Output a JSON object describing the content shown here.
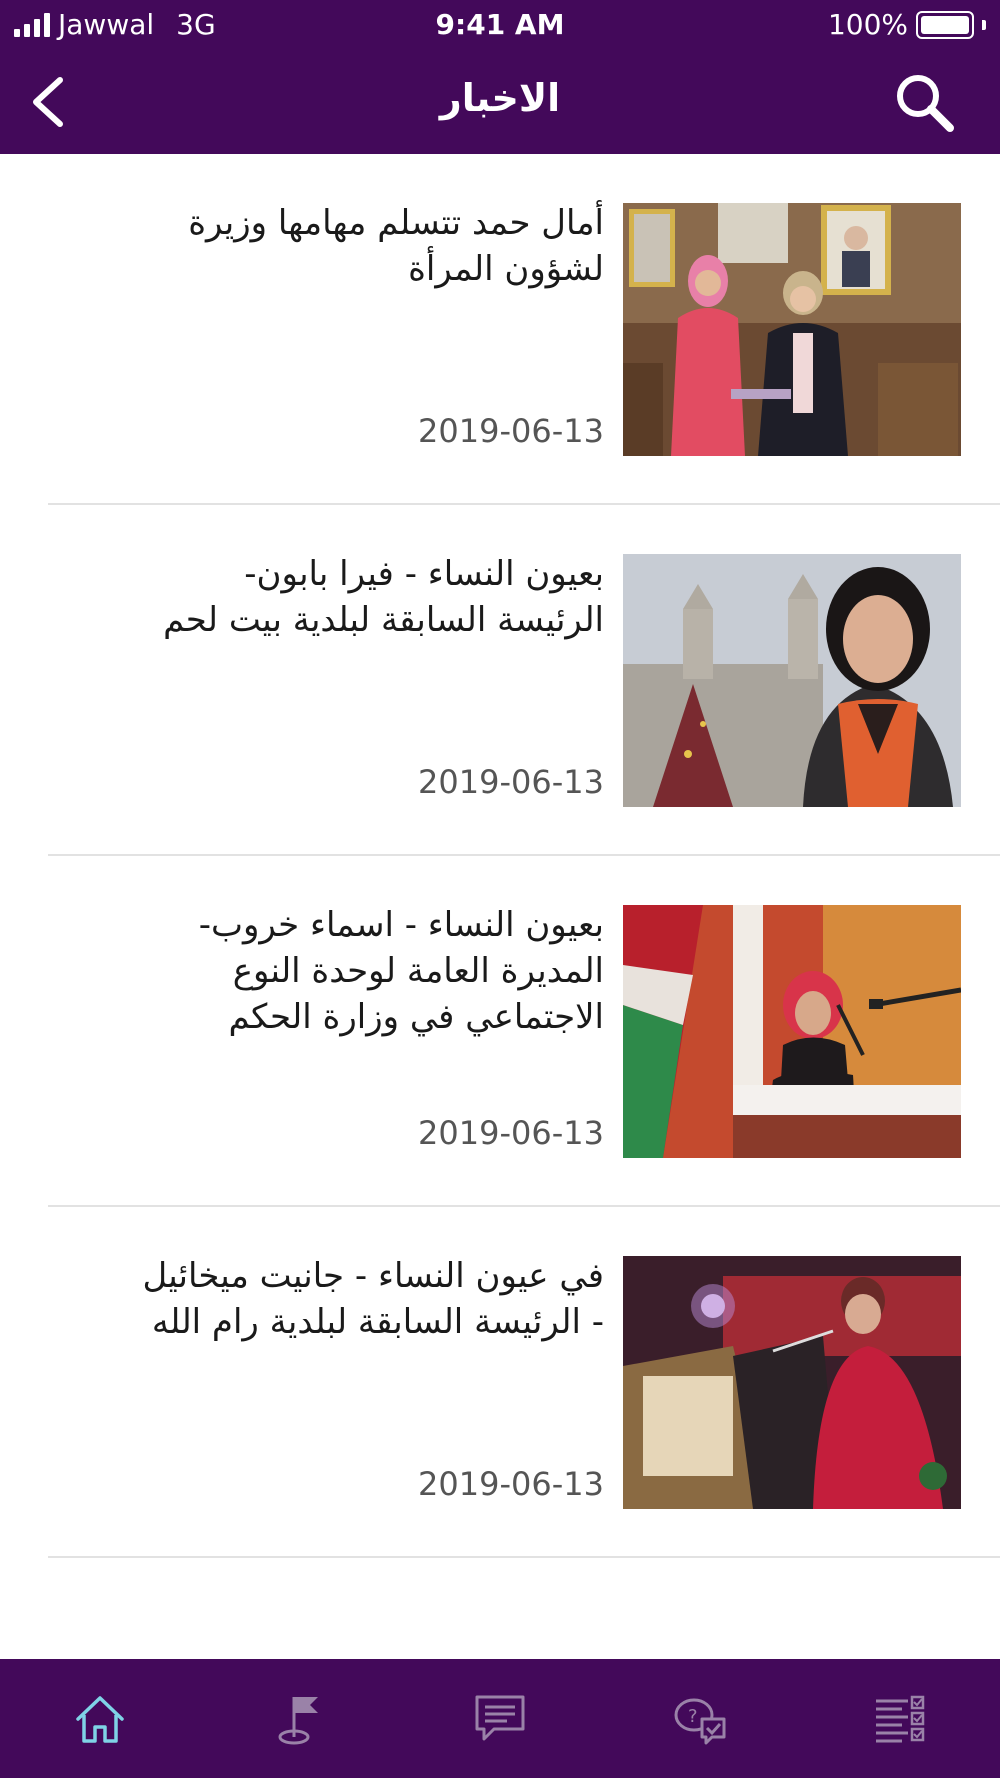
{
  "status_bar": {
    "carrier": "Jawwal",
    "network": "3G",
    "time": "9:41 AM",
    "battery": "100%"
  },
  "header": {
    "title": "الاخبار",
    "back_icon": "chevron-left-icon",
    "search_icon": "search-icon"
  },
  "news": [
    {
      "title": "أمال حمد تتسلم مهامها وزيرة لشؤون المرأة",
      "date": "2019-06-13",
      "image": "photo-ceremony"
    },
    {
      "title": "بعيون النساء - فيرا بابون- الرئيسة السابقة لبلدية بيت لحم",
      "date": "2019-06-13",
      "image": "photo-portrait"
    },
    {
      "title": "بعيون النساء - اسماء خروب- المديرة العامة لوحدة النوع الاجتماعي في وزارة الحكم",
      "date": "2019-06-13",
      "image": "photo-speaker"
    },
    {
      "title": "في عيون النساء - جانيت ميخائيل - الرئيسة السابقة لبلدية رام الله",
      "date": "2019-06-13",
      "image": "photo-podium"
    }
  ],
  "tab_bar": {
    "tabs": [
      {
        "icon": "home-icon",
        "active": true
      },
      {
        "icon": "flag-pin-icon",
        "active": false
      },
      {
        "icon": "chat-icon",
        "active": false
      },
      {
        "icon": "question-chat-icon",
        "active": false
      },
      {
        "icon": "checklist-icon",
        "active": false
      }
    ]
  },
  "colors": {
    "brand": "#43095a",
    "active_tab": "#7fd3e6",
    "inactive_tab": "#9a82a8"
  }
}
